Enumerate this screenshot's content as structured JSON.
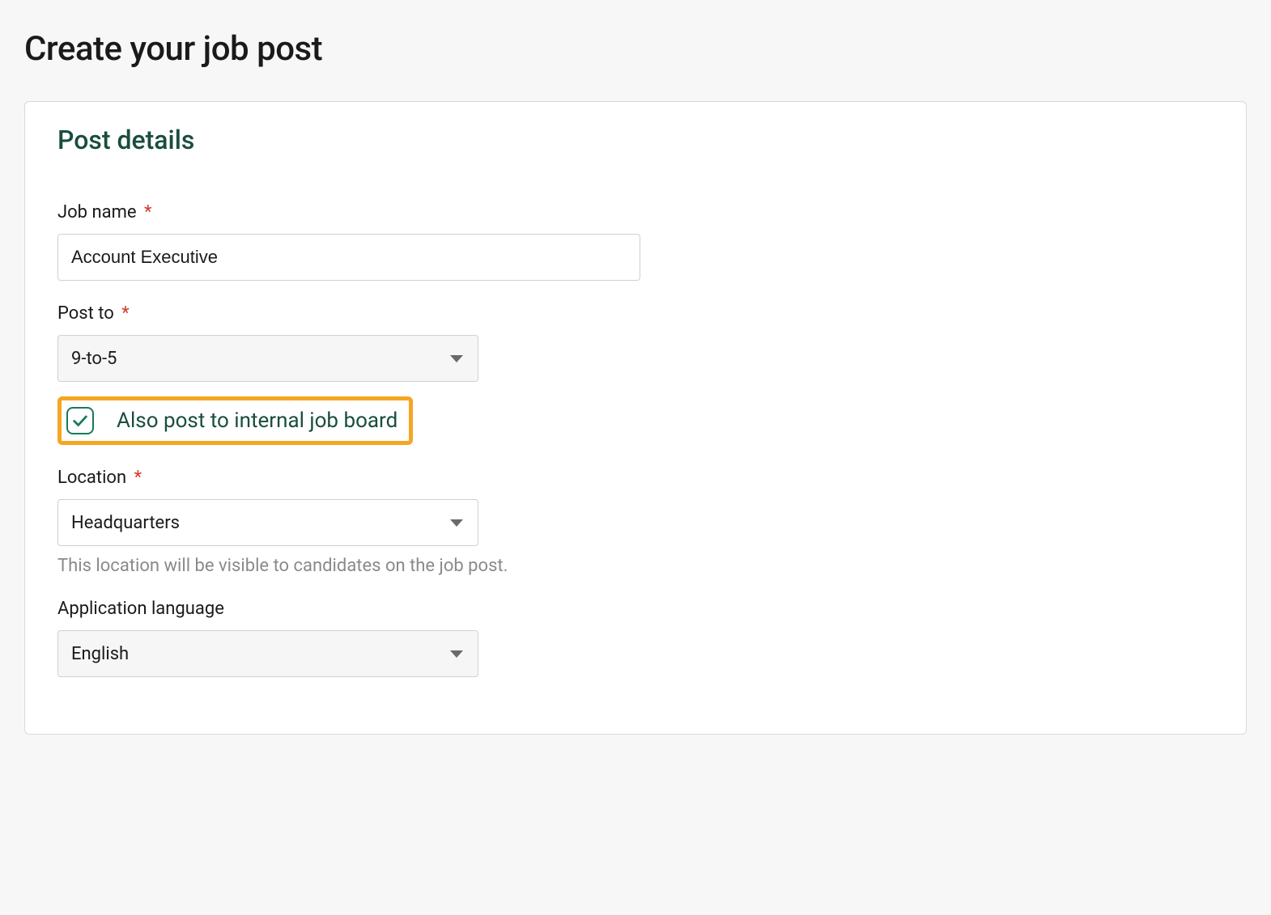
{
  "page": {
    "title": "Create your job post"
  },
  "card": {
    "title": "Post details"
  },
  "fields": {
    "job_name": {
      "label": "Job name",
      "value": "Account Executive"
    },
    "post_to": {
      "label": "Post to",
      "value": "9-to-5"
    },
    "internal_checkbox": {
      "label": "Also post to internal job board",
      "checked": true
    },
    "location": {
      "label": "Location",
      "value": "Headquarters",
      "hint": "This location will be visible to candidates on the job post."
    },
    "language": {
      "label": "Application language",
      "value": "English"
    }
  },
  "required_marker": "*"
}
